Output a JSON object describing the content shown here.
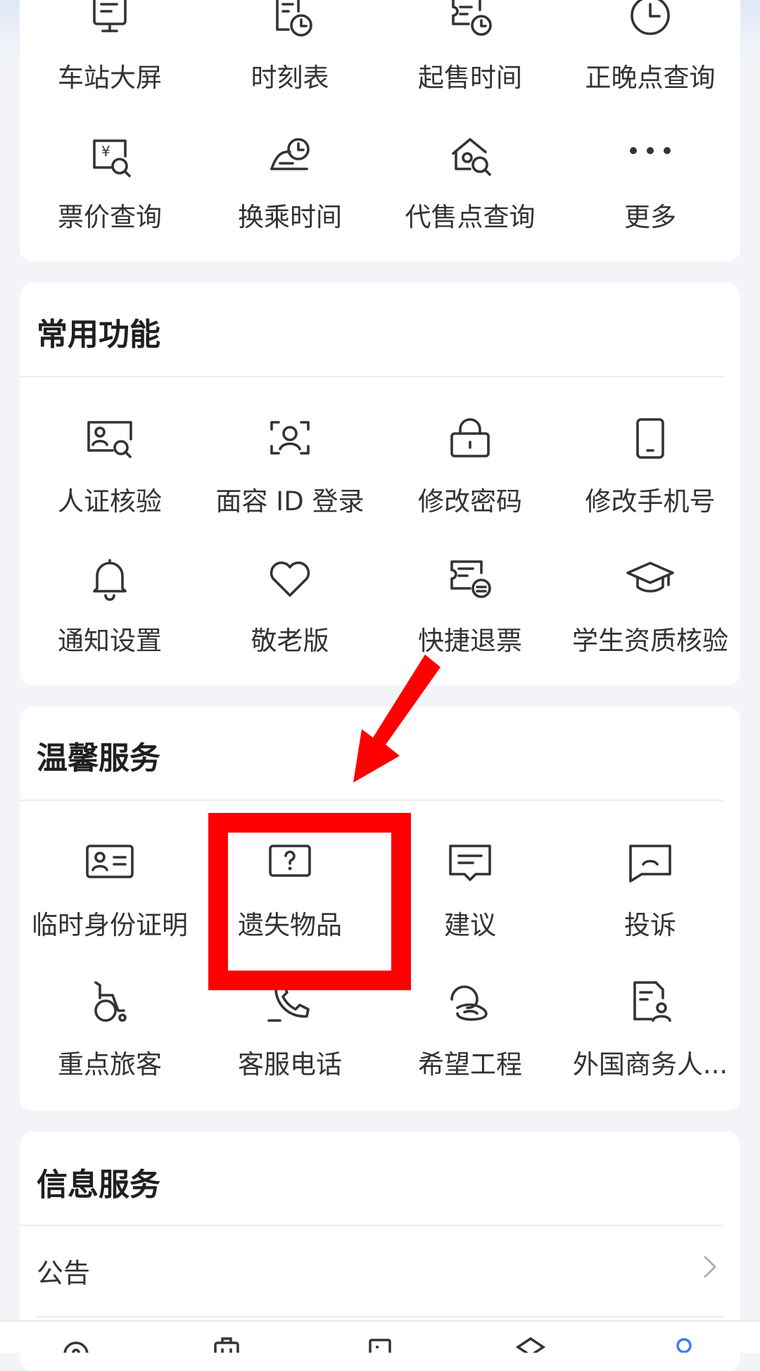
{
  "quick_grid": {
    "items": [
      {
        "label": "车站大屏",
        "icon": "station-screen-icon"
      },
      {
        "label": "时刻表",
        "icon": "timetable-icon"
      },
      {
        "label": "起售时间",
        "icon": "sale-time-icon"
      },
      {
        "label": "正晚点查询",
        "icon": "clock-icon"
      },
      {
        "label": "票价查询",
        "icon": "fare-query-icon"
      },
      {
        "label": "换乘时间",
        "icon": "transfer-time-icon"
      },
      {
        "label": "代售点查询",
        "icon": "agency-query-icon"
      },
      {
        "label": "更多",
        "icon": "more-icon"
      }
    ]
  },
  "common": {
    "title": "常用功能",
    "items": [
      {
        "label": "人证核验",
        "icon": "id-verify-icon"
      },
      {
        "label": "面容 ID 登录",
        "icon": "face-id-icon"
      },
      {
        "label": "修改密码",
        "icon": "lock-icon"
      },
      {
        "label": "修改手机号",
        "icon": "phone-icon"
      },
      {
        "label": "通知设置",
        "icon": "bell-icon"
      },
      {
        "label": "敬老版",
        "icon": "heart-icon"
      },
      {
        "label": "快捷退票",
        "icon": "refund-ticket-icon"
      },
      {
        "label": "学生资质核验",
        "icon": "graduation-cap-icon"
      }
    ]
  },
  "warm": {
    "title": "温馨服务",
    "items": [
      {
        "label": "临时身份证明",
        "icon": "temp-id-icon"
      },
      {
        "label": "遗失物品",
        "icon": "lost-item-icon"
      },
      {
        "label": "建议",
        "icon": "suggestion-icon"
      },
      {
        "label": "投诉",
        "icon": "complaint-icon"
      },
      {
        "label": "重点旅客",
        "icon": "wheelchair-icon"
      },
      {
        "label": "客服电话",
        "icon": "phone-call-icon"
      },
      {
        "label": "希望工程",
        "icon": "hope-project-icon"
      },
      {
        "label": "外国商务人...",
        "icon": "foreign-business-icon"
      }
    ]
  },
  "info": {
    "title": "信息服务",
    "rows": [
      {
        "label": "公告"
      }
    ]
  },
  "colors": {
    "highlight": "#ff0000",
    "accent": "#3b7cf6"
  }
}
